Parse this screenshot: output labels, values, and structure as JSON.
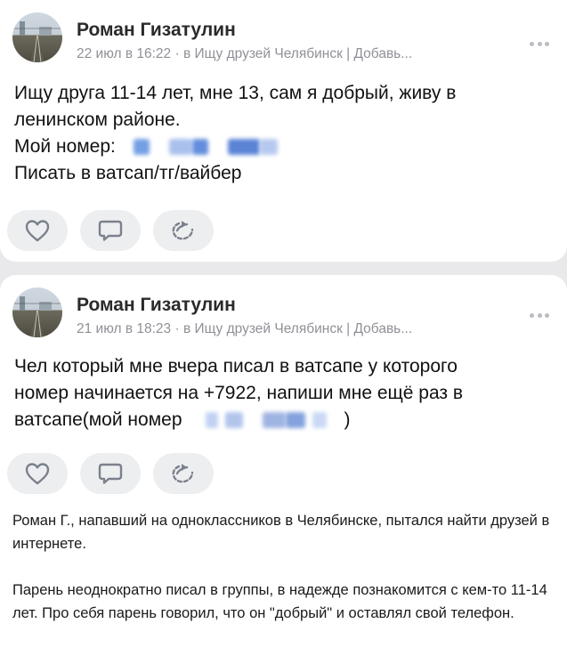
{
  "posts": [
    {
      "author": "Роман Гизатулин",
      "meta": "22 июл в 16:22 · в Ищу друзей Челябинск | Добавь...",
      "lines": [
        "Ищу друга 11-14 лет, мне 13, сам я добрый, живу в",
        "ленинском районе.",
        "Мой номер:",
        "Писать в ватсап/тг/вайбер"
      ]
    },
    {
      "author": "Роман Гизатулин",
      "meta": "21 июл в 18:23 · в Ищу друзей Челябинск | Добавь...",
      "lines": [
        "Чел который мне вчера писал в ватсапе у которого",
        "номер начинается на +7922, напиши мне ещё раз в",
        "ватсапе(мой номер",
        ")"
      ]
    }
  ],
  "icons": {
    "like": "heart-icon",
    "comment": "comment-icon",
    "share": "share-icon",
    "more": "more-dots-icon"
  },
  "colors": {
    "card_bg": "#ffffff",
    "screen_bg": "#e9e9ec",
    "meta_text": "#8f9197",
    "action_bg": "#edeef0",
    "icon_stroke": "#7b818c",
    "redaction_blue": "#4a7bd8"
  },
  "caption": {
    "p1": "Роман Г., напавший на одноклассников в Челябинске, пытался найти друзей в интернете.",
    "p2": "Парень неоднократно писал в группы, в надежде познакомится с кем-то 11-14 лет. Про себя парень говорил, что он \"добрый\" и оставлял свой телефон."
  }
}
